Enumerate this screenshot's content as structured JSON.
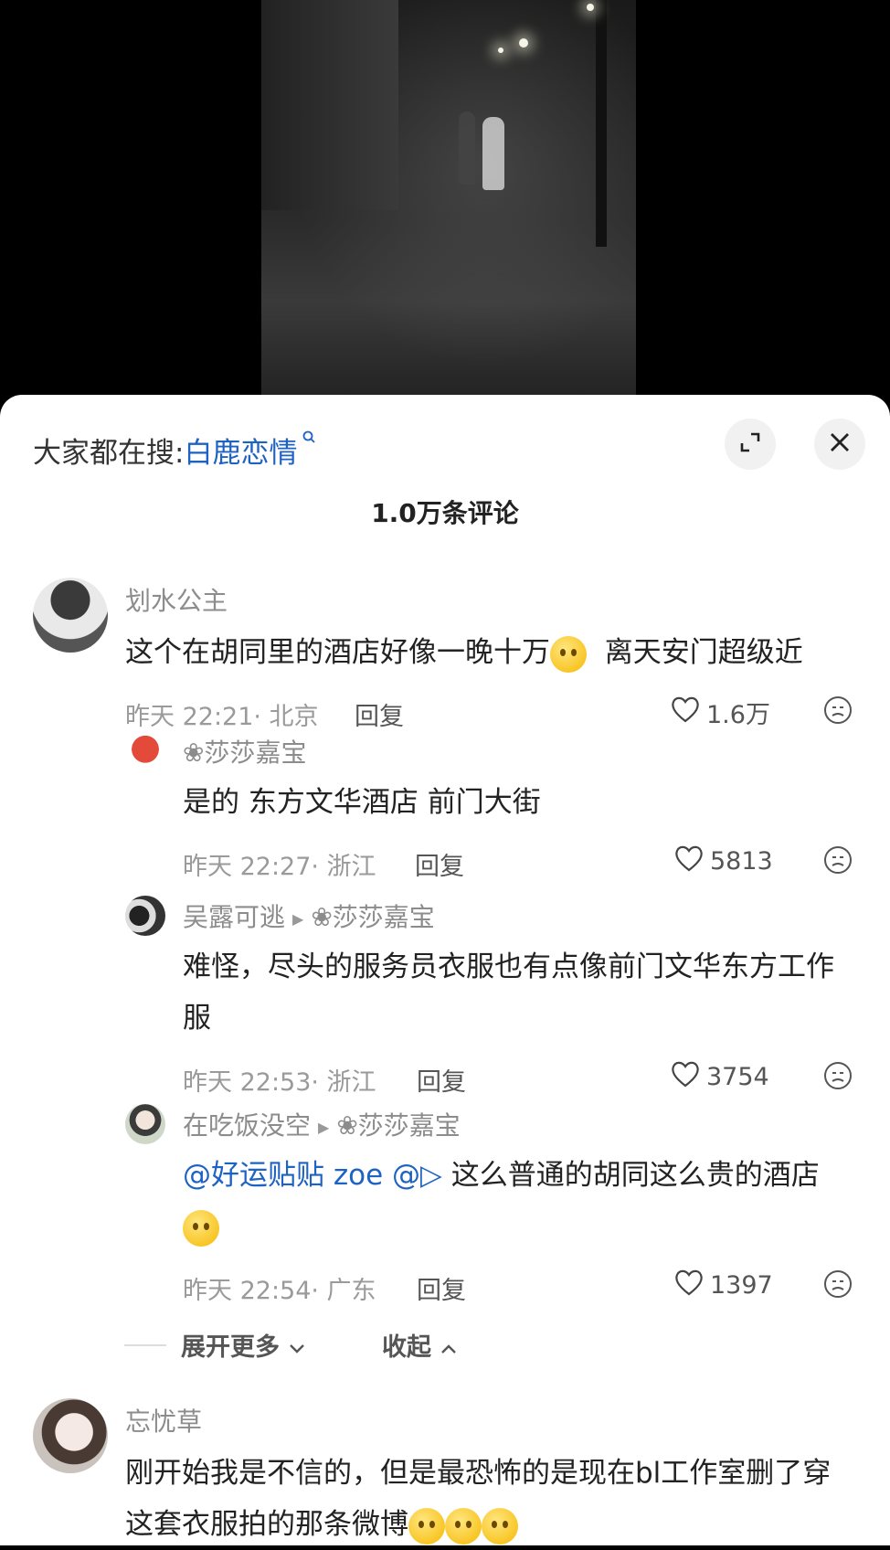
{
  "search": {
    "prefix": "大家都在搜:",
    "term": "白鹿恋情",
    "search_icon": "search-icon"
  },
  "header": {
    "expand_icon": "expand-icon",
    "close_icon": "close-icon",
    "comment_count": "1.0万条评论"
  },
  "comments": [
    {
      "user": "划水公主",
      "text_a": "这个在胡同里的酒店好像一晚十万",
      "text_b": "离天安门超级近",
      "meta": "昨天 22:21· 北京",
      "reply": "回复",
      "likes": "1.6万"
    },
    {
      "user": "❀莎莎嘉宝",
      "text": "是的 东方文华酒店 前门大街",
      "meta": "昨天 22:27· 浙江",
      "reply": "回复",
      "likes": "5813"
    },
    {
      "user": "吴露可逃",
      "reply_to": "❀莎莎嘉宝",
      "text": "难怪，尽头的服务员衣服也有点像前门文华东方工作服",
      "meta": "昨天 22:53· 浙江",
      "reply": "回复",
      "likes": "3754"
    },
    {
      "user": "在吃饭没空",
      "reply_to": "❀莎莎嘉宝",
      "mention": "@好运贴贴 zoe @▷",
      "text": "这么普通的胡同这么贵的酒店",
      "meta": "昨天 22:54· 广东",
      "reply": "回复",
      "likes": "1397"
    },
    {
      "user": "忘忧草",
      "text": "刚开始我是不信的，但是最恐怖的是现在bl工作室删了穿这套衣服拍的那条微博"
    }
  ],
  "thread_controls": {
    "expand_more": "展开更多",
    "collapse": "收起"
  },
  "colors": {
    "link": "#1e62c3",
    "username": "#8c8c8c",
    "text": "#222222"
  }
}
